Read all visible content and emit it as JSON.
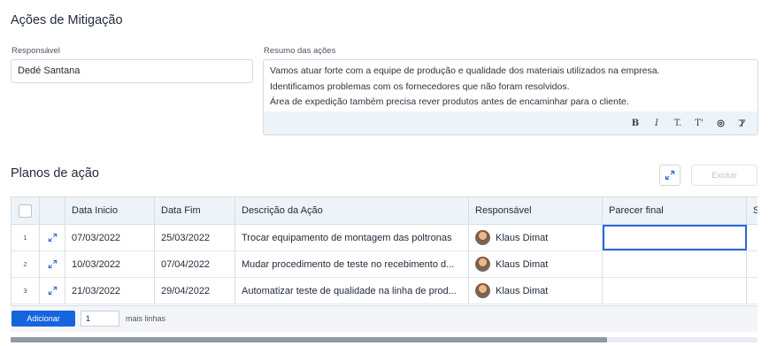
{
  "section": {
    "title": "Ações de Mitigação",
    "responsavel_label": "Responsável",
    "responsavel_value": "Dedé Santana",
    "resumo_label": "Resumo das ações",
    "resumo_lines": [
      "Vamos atuar forte com a equipe de produção e qualidade dos materiais utilizados na empresa.",
      "Identificamos problemas com os fornecedores que não foram resolvidos.",
      "Área de expedição também precisa rever produtos antes de encaminhar para o cliente."
    ],
    "toolbar": {
      "bold": "B",
      "italic": "I",
      "subscript": "T.",
      "superscript": "T'",
      "link_icon": "link-icon",
      "clear_icon": "clear-format-icon"
    }
  },
  "plans": {
    "title": "Planos de ação",
    "expand_icon": "expand-icon",
    "delete_label": "Excluir",
    "columns": [
      "Data Inicio",
      "Data Fim",
      "Descrição da Ação",
      "Responsável",
      "Parecer final",
      "S"
    ],
    "rows": [
      {
        "num": "1",
        "inicio": "07/03/2022",
        "fim": "25/03/2022",
        "descricao": "Trocar equipamento de montagem das poltronas",
        "responsavel": "Klaus Dimat",
        "parecer": ""
      },
      {
        "num": "2",
        "inicio": "10/03/2022",
        "fim": "07/04/2022",
        "descricao": "Mudar procedimento de teste no recebimento d...",
        "responsavel": "Klaus Dimat",
        "parecer": ""
      },
      {
        "num": "3",
        "inicio": "21/03/2022",
        "fim": "29/04/2022",
        "descricao": "Automatizar teste de qualidade na linha de prod...",
        "responsavel": "Klaus Dimat",
        "parecer": ""
      }
    ],
    "footer": {
      "add_label": "Adicionar",
      "add_qty": "1",
      "more_lines": "mais linhas"
    }
  },
  "colors": {
    "accent": "#1565e0",
    "selection": "#2b66d9",
    "header_bg": "#eef3f8"
  }
}
